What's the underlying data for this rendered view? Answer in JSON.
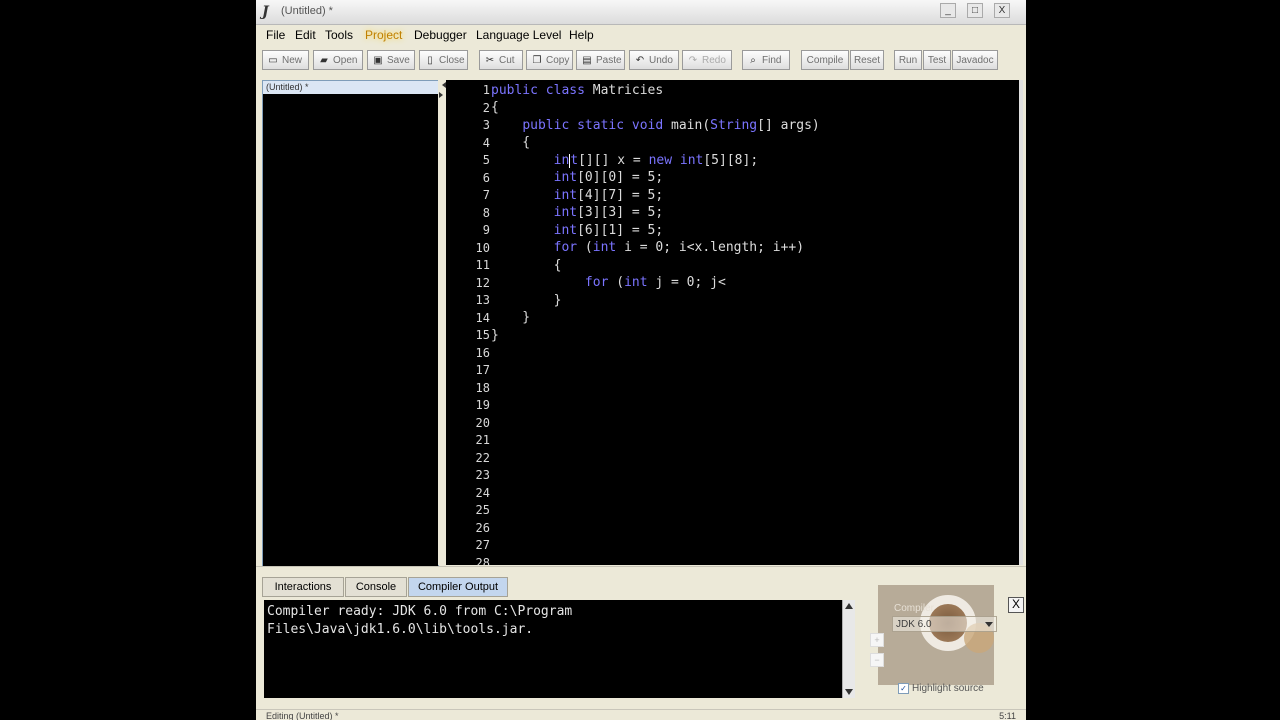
{
  "window": {
    "title": "(Untitled) *",
    "controls": {
      "minimize": "_",
      "maximize": "□",
      "close": "X"
    }
  },
  "menu": [
    "File",
    "Edit",
    "Tools",
    "Project",
    "Debugger",
    "Language Level",
    "Help"
  ],
  "menu_highlighted": "Project",
  "toolbar": {
    "new": "New",
    "open": "Open",
    "save": "Save",
    "close": "Close",
    "cut": "Cut",
    "copy": "Copy",
    "paste": "Paste",
    "undo": "Undo",
    "redo": "Redo",
    "find": "Find",
    "compile": "Compile",
    "reset": "Reset",
    "run": "Run",
    "test": "Test",
    "javadoc": "Javadoc"
  },
  "documents": [
    "(Untitled) *"
  ],
  "editor": {
    "line_numbers": [
      "1",
      "2",
      "3",
      "4",
      "5",
      "6",
      "7",
      "8",
      "9",
      "10",
      "11",
      "12",
      "13",
      "14",
      "15",
      "16",
      "17",
      "18",
      "19",
      "20",
      "21",
      "22",
      "23",
      "24",
      "25",
      "26",
      "27",
      "28"
    ],
    "code": [
      "public class Matricies",
      "{",
      "    public static void main(String[] args)",
      "    {",
      "        int[][] x = new int[5][8];",
      "        int[0][0] = 5;",
      "        int[4][7] = 5;",
      "        int[3][3] = 5;",
      "        int[6][1] = 5;",
      "        for (int i = 0; i<x.length; i++)",
      "        {",
      "            for (int j = 0; j<",
      "        }",
      "    }",
      "}"
    ]
  },
  "tabs": [
    "Interactions",
    "Console",
    "Compiler Output"
  ],
  "active_tab": "Compiler Output",
  "output": {
    "lines": [
      "Compiler ready: JDK 6.0 from C:\\Program",
      "Files\\Java\\jdk1.6.0\\lib\\tools.jar."
    ]
  },
  "compiler_panel": {
    "label": "Compiler",
    "selected": "JDK 6.0",
    "highlight_label": "Highlight source",
    "highlight_checked": true,
    "close": "X"
  },
  "status": {
    "left": "Editing (Untitled) *",
    "right": "5:11"
  },
  "colors": {
    "keyword": "#7b74ff",
    "editor_bg": "#000000",
    "chrome": "#ece9d8",
    "active_tab": "#c3d6ee"
  }
}
